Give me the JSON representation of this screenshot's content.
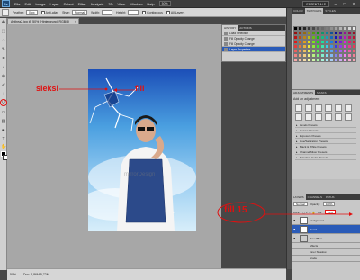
{
  "app": {
    "logo": "Ps",
    "workspace": "ESSENTIALS",
    "zoom": "50%"
  },
  "menu": [
    "File",
    "Edit",
    "Image",
    "Layer",
    "Select",
    "Filter",
    "Analysis",
    "3D",
    "View",
    "Window",
    "Help"
  ],
  "options": {
    "feather_label": "Feather:",
    "feather_value": "0 px",
    "style_label": "Style:",
    "style_value": "Normal",
    "width_label": "Width:",
    "height_label": "Height:",
    "antialias": "Anti-alias",
    "contiguous": "Contiguous",
    "all_layers": "All Layers"
  },
  "document": {
    "tab_title": "Anthea2.jpg @ 50% (Hintergrund, RGB/8)",
    "close": "×"
  },
  "status": {
    "zoom": "50%",
    "doc_size": "Doc: 2,86M/5,72M"
  },
  "history": {
    "tabs": [
      "HISTORY",
      "ACTIONS"
    ],
    "rows": [
      {
        "label": "Load Selection",
        "selected": false
      },
      {
        "label": "Fill Opacity Change",
        "selected": false
      },
      {
        "label": "Fill Opacity Change",
        "selected": false
      },
      {
        "label": "Layer Properties",
        "selected": true
      }
    ]
  },
  "right_panels": {
    "top_tabs": [
      "COLOR",
      "SWATCHES",
      "STYLES"
    ],
    "adj_tabs": [
      "ADJUSTMENTS",
      "MASKS"
    ],
    "adj_title": "Add an adjustment",
    "presets": [
      "Levels Presets",
      "Curves Presets",
      "Exposure Presets",
      "Hue/Saturation Presets",
      "Black & White Presets",
      "Channel Mixer Presets",
      "Selective Color Presets"
    ],
    "layers_tabs": [
      "LAYERS",
      "CHANNELS",
      "PATHS"
    ],
    "blend_mode": "Normal",
    "opacity_label": "Opacity:",
    "opacity_value": "100%",
    "lock_label": "Lock:",
    "fill_label": "Fill:",
    "fill_value": "15%",
    "layers": [
      {
        "name": "background",
        "selected": false
      },
      {
        "name": "Ikewd",
        "selected": true
      },
      {
        "name": "Bevel/Blue",
        "selected": false
      },
      {
        "name": "Effects",
        "selected": false
      },
      {
        "name": "Inner Shadow",
        "selected": false
      },
      {
        "name": "Erode",
        "selected": false
      }
    ]
  },
  "annotations": {
    "seleksi": "sleksi",
    "fill": "fill",
    "fill15": "fill 15"
  },
  "watermark": "mirrorDesign",
  "colors": {
    "annotation_red": "#e01010",
    "selection_blue": "#2a5bb8",
    "sky_blue": "#4a9fe0"
  }
}
